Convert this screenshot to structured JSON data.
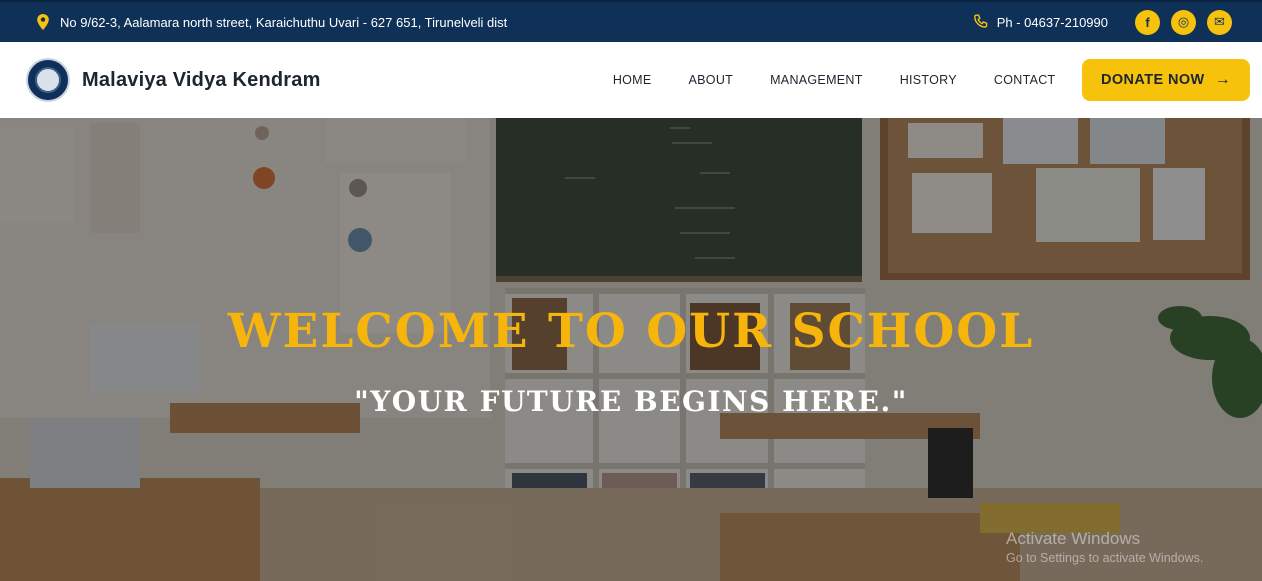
{
  "topbar": {
    "address": "No 9/62-3, Aalamara north street, Karaichuthu Uvari - 627 651, Tirunelveli dist",
    "phone": "Ph - 04637-210990",
    "social": [
      {
        "icon": "facebook-icon",
        "glyph": "f"
      },
      {
        "icon": "instagram-icon",
        "glyph": "◎"
      },
      {
        "icon": "mail-icon",
        "glyph": "✉"
      }
    ]
  },
  "navbar": {
    "brand": "Malaviya Vidya Kendram",
    "links": [
      "HOME",
      "ABOUT",
      "MANAGEMENT",
      "HISTORY",
      "CONTACT"
    ],
    "donate_label": "DONATE NOW",
    "donate_arrow": "→"
  },
  "hero": {
    "headline": "WELCOME TO OUR SCHOOL",
    "tagline": "\"YOUR FUTURE BEGINS HERE.\""
  },
  "os_watermark": {
    "title": "Activate Windows",
    "subtitle": "Go to Settings to activate Windows."
  },
  "colors": {
    "topbar_bg": "#0f3057",
    "accent": "#f7c20b",
    "headline": "#f7b50b"
  }
}
